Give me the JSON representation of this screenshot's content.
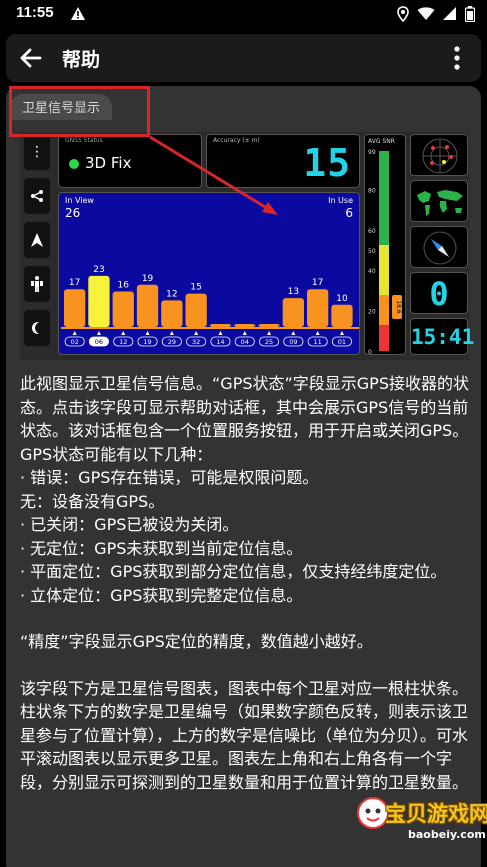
{
  "status_bar": {
    "time": "11:55"
  },
  "app_bar": {
    "title": "帮助"
  },
  "tab_label": "卫星信号显示",
  "gps_status": {
    "label": "GNSS Status",
    "value": "3D Fix"
  },
  "accuracy": {
    "label": "Accuracy (± m)",
    "value": "15"
  },
  "sat_chart": {
    "in_view_label": "In View",
    "in_view": "26",
    "in_use_label": "In Use",
    "in_use": "6"
  },
  "chart_data": {
    "type": "bar",
    "categories": [
      "02",
      "06",
      "12",
      "19",
      "29",
      "32",
      "14",
      "04",
      "25",
      "09",
      "11",
      "01"
    ],
    "values": [
      17,
      23,
      16,
      19,
      12,
      15,
      0,
      0,
      0,
      13,
      17,
      10
    ],
    "bar_labels": [
      "17",
      "23",
      "16",
      "19",
      "12",
      "15",
      "",
      "",
      "",
      "13",
      "17",
      "10"
    ],
    "in_use": [
      false,
      true,
      false,
      false,
      false,
      false,
      false,
      false,
      false,
      false,
      false,
      false
    ],
    "colors": {
      "normal": "#f7931e",
      "highlight": "#f9f23a",
      "low": "#f7931e"
    }
  },
  "snr": {
    "label": "AVG SNR",
    "ticks": [
      "99",
      "80",
      "60",
      "50",
      "40",
      "20",
      "0"
    ],
    "avg": "18.6"
  },
  "speed": "0",
  "clock": "15:41",
  "body": {
    "p1": "此视图显示卫星信号信息。“GPS状态”字段显示GPS接收器的状态。点击该字段可显示帮助对话框，其中会展示GPS信号的当前状态。该对话框包含一个位置服务按钮，用于开启或关闭GPS。GPS状态可能有以下几种：",
    "l1": "· 错误：GPS存在错误，可能是权限问题。",
    "l2": "无：设备没有GPS。",
    "l3": "· 已关闭：GPS已被设为关闭。",
    "l4": "· 无定位：GPS未获取到当前定位信息。",
    "l5": "· 平面定位：GPS获取到部分定位信息，仅支持经纬度定位。",
    "l6": "· 立体定位：GPS获取到完整定位信息。",
    "p2": "“精度”字段显示GPS定位的精度，数值越小越好。",
    "p3": "该字段下方是卫星信号图表，图表中每个卫星对应一根柱状条。柱状条下方的数字是卫星编号（如果数字颜色反转，则表示该卫星参与了位置计算），上方的数字是信噪比（单位为分贝）。可水平滚动图表以显示更多卫星。图表左上角和右上角各有一个字段，分别显示可探测到的卫星数量和用于位置计算的卫星数量。"
  },
  "watermark": {
    "main": "宝贝游戏网",
    "sub": "baobeiy.com"
  }
}
